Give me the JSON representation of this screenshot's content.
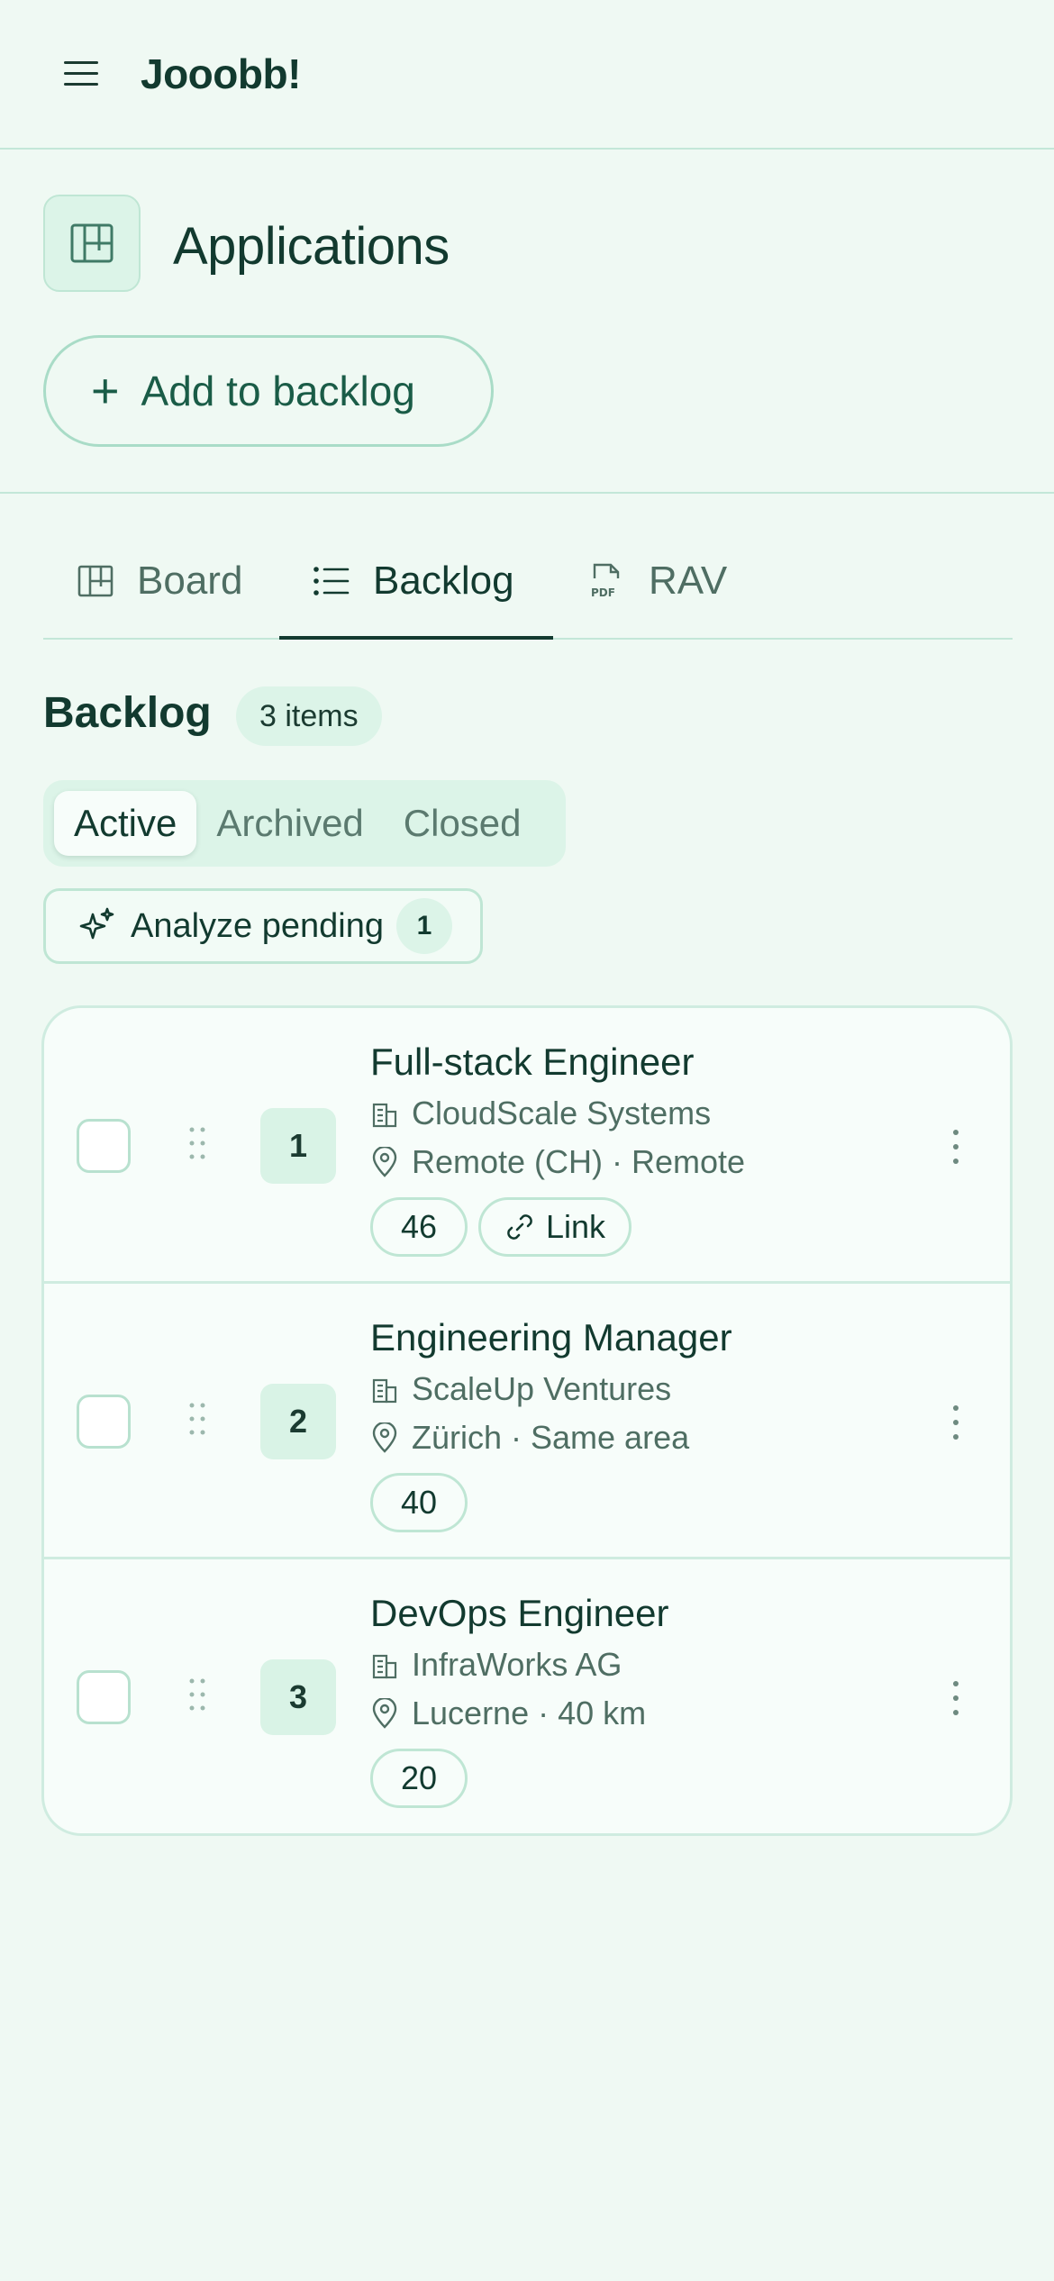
{
  "app": {
    "brand": "Jooobb!"
  },
  "page": {
    "title": "Applications",
    "add_button": "Add to backlog"
  },
  "tabs": [
    {
      "label": "Board",
      "icon": "board-icon"
    },
    {
      "label": "Backlog",
      "icon": "list-icon",
      "active": true
    },
    {
      "label": "RAV",
      "icon": "pdf-icon"
    }
  ],
  "backlog": {
    "title": "Backlog",
    "count": "3 items",
    "filters": [
      "Active",
      "Archived",
      "Closed"
    ],
    "active_filter": "Active",
    "analyze_label": "Analyze pending",
    "analyze_count": "1"
  },
  "jobs": [
    {
      "rank": "1",
      "title": "Full-stack Engineer",
      "company": "CloudScale Systems",
      "location": "Remote (CH) · Remote",
      "score": "46",
      "link_label": "Link"
    },
    {
      "rank": "2",
      "title": "Engineering Manager",
      "company": "ScaleUp Ventures",
      "location": "Zürich · Same area",
      "score": "40"
    },
    {
      "rank": "3",
      "title": "DevOps Engineer",
      "company": "InfraWorks AG",
      "location": "Lucerne · 40 km",
      "score": "20"
    }
  ],
  "colors": {
    "background": "#eff9f3",
    "accent": "#1a5c47",
    "border": "#c3e7d8",
    "chip": "#dcf4e8",
    "text": "#123a2f"
  }
}
